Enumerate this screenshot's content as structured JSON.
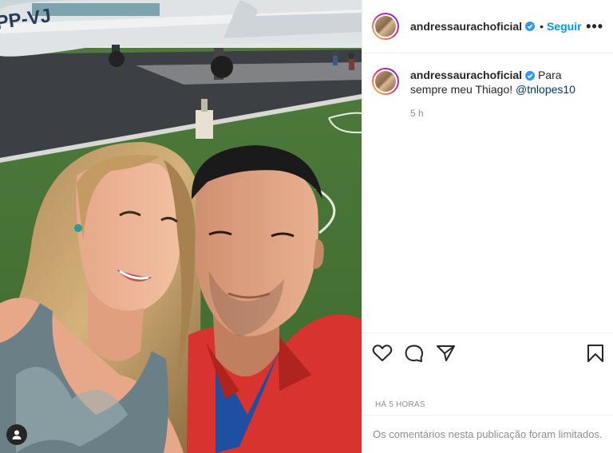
{
  "post": {
    "username": "andressaurachoficial",
    "follow_label": "Seguir",
    "separator": "•",
    "more_label": "•••",
    "caption_text": "Para sempre meu Thiago!",
    "caption_mention": "@tnlopes10",
    "relative_time": "5 h",
    "timestamp_label": "HÁ 5 HORAS",
    "comments_limited": "Os comentários nesta publicação foram limitados."
  },
  "photo": {
    "aircraft_marking": "PP-VJ"
  },
  "icons": {
    "like": "heart-icon",
    "comment": "comment-icon",
    "share": "share-icon",
    "save": "bookmark-icon",
    "verified": "verified-badge-icon",
    "tagged_user": "user-tag-icon"
  },
  "colors": {
    "link": "#0095f6",
    "verified": "#3897f0",
    "mention": "#00376b",
    "muted": "#8e8e8e",
    "text": "#262626"
  }
}
